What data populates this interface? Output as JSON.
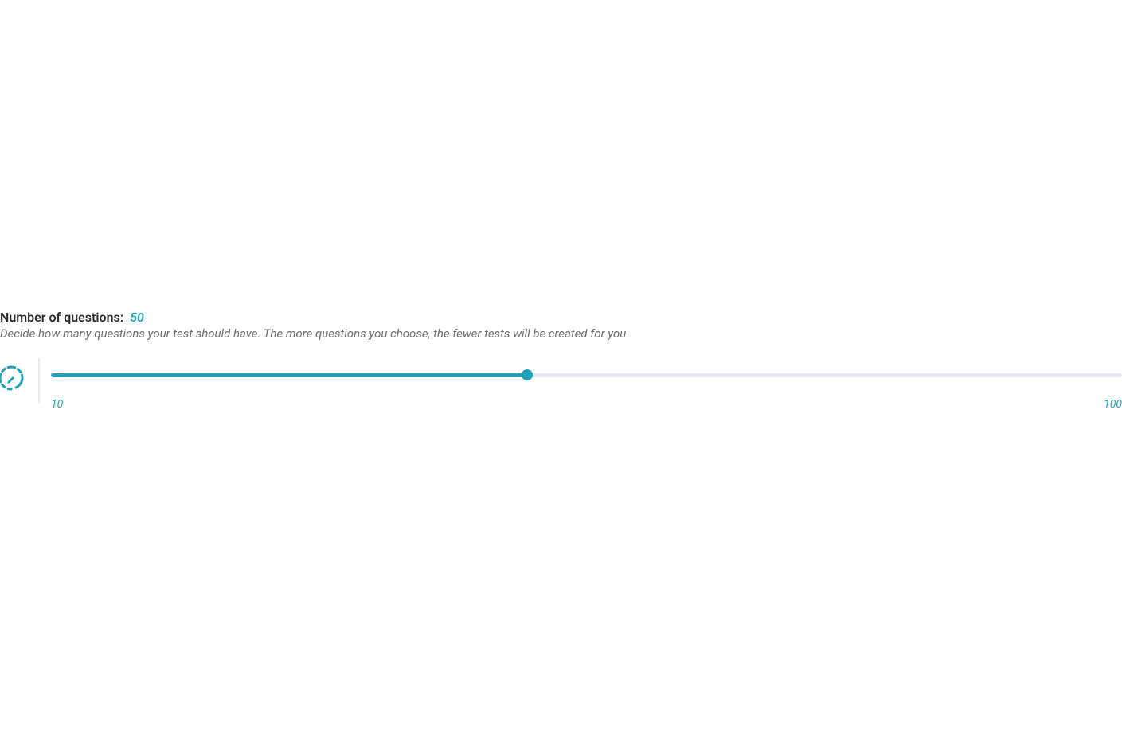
{
  "title": {
    "label": "Number of questions:",
    "value": "50"
  },
  "description": "Decide how many questions your test should have. The more questions you choose, the fewer tests will be created for you.",
  "slider": {
    "min": 10,
    "max": 100,
    "value": 50,
    "min_label": "10",
    "max_label": "100",
    "fill_percent": "44.444%"
  },
  "colors": {
    "accent": "#1ca3b9"
  }
}
